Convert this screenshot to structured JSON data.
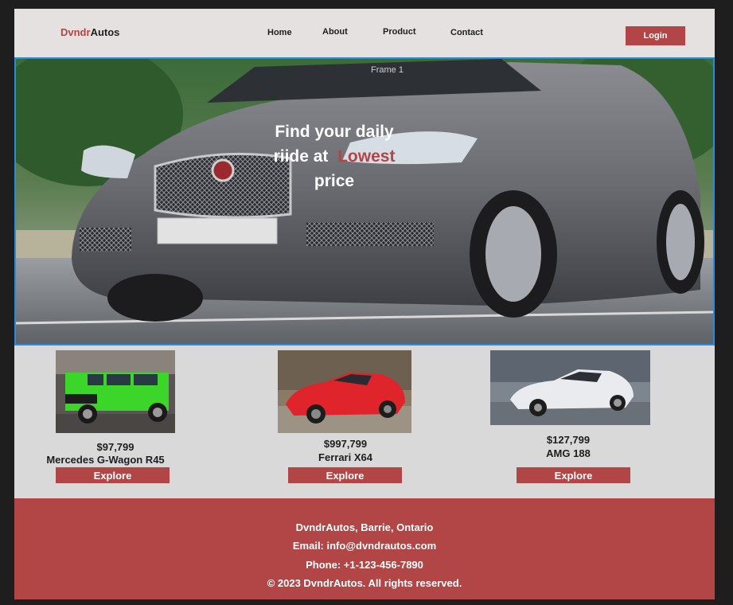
{
  "header": {
    "logo_part1": "Dvndr",
    "logo_part2": "Autos",
    "nav": [
      "Home",
      "About",
      "Product",
      "Contact"
    ],
    "login_label": "Login"
  },
  "hero": {
    "frame_label": "Frame 1",
    "headline_line1": "Find your daily",
    "headline_line2": "riide at",
    "headline_highlight": "Lowest",
    "headline_line3": "price"
  },
  "products": [
    {
      "price": "$97,799",
      "name": "Mercedes G-Wagon R45",
      "button": "Explore"
    },
    {
      "price": "$997,799",
      "name": "Ferrari X64",
      "button": "Explore"
    },
    {
      "price": "$127,799",
      "name": "AMG 188",
      "button": "Explore"
    }
  ],
  "footer": {
    "line1": "DvndrAutos, Barrie, Ontario",
    "line2": "Email: info@dvndrautos.com",
    "line3": "Phone: +1-123-456-7890",
    "line4": "© 2023 DvndrAutos. All rights reserved."
  },
  "colors": {
    "brand": "#b24646",
    "header_bg": "#e6e1e1",
    "body_bg": "#d9d9d9",
    "frame_border": "#2a8be0"
  }
}
